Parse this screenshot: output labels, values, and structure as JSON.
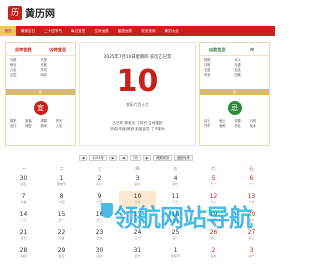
{
  "header": {
    "logo_mark": "历",
    "site_name": "黄历网"
  },
  "nav": [
    {
      "label": "首页",
      "active": true
    },
    {
      "label": "黄道吉日"
    },
    {
      "label": "二十四节气"
    },
    {
      "label": "每日宜忌"
    },
    {
      "label": "生肖运势"
    },
    {
      "label": "星座运势"
    },
    {
      "label": "农历查询"
    },
    {
      "label": "黄历大全"
    }
  ],
  "left_panel": {
    "head_left": "吉神宜趋",
    "head_right": "凶神宜忌",
    "text": [
      "月德",
      "天恩",
      "母仓",
      "天赦",
      "六合",
      "不将",
      "玉堂",
      "鸣吠"
    ],
    "bar": "宜",
    "seal": "宜",
    "items": [
      "祭祀",
      "祈福",
      "求嗣",
      "开光",
      "出行",
      "嫁娶",
      "纳采",
      "入宅"
    ]
  },
  "center": {
    "date_line": "2025年7月10日星期四 农历乙巳年",
    "day": "10",
    "lunar": "农历六月十六",
    "ganzhi_1": "乙巳年 癸未月 丁卯日 生肖属蛇",
    "ganzhi_2": "冲鸡(辛酉)煞西 彭祖百忌 丁不剃头"
  },
  "right_panel": {
    "head_left": "凶煞宜忌",
    "head_right": "冲",
    "text": [
      "劫煞",
      "天火",
      "月煞",
      "月虚",
      "五虚",
      "血支",
      "朱雀",
      "四耗"
    ],
    "bar": "忌",
    "seal": "忌",
    "items": [
      "动土",
      "破土",
      "安葬",
      "行丧",
      "开市",
      "栽种",
      "作灶",
      "伐木"
    ]
  },
  "controls": {
    "year": "2025年",
    "month": "7月",
    "holiday": "假期安排",
    "back_today": "返回今天"
  },
  "weekdays": [
    "一",
    "二",
    "三",
    "四",
    "五",
    "六",
    "日"
  ],
  "calendar": [
    {
      "d": "30",
      "l": "初五"
    },
    {
      "d": "1",
      "l": "建党节"
    },
    {
      "d": "2",
      "l": "初八"
    },
    {
      "d": "3",
      "l": "初九"
    },
    {
      "d": "4",
      "l": "初十"
    },
    {
      "d": "5",
      "l": "十一"
    },
    {
      "d": "6",
      "l": "十二"
    },
    {
      "d": "7",
      "l": "小暑"
    },
    {
      "d": "8",
      "l": "十四"
    },
    {
      "d": "9",
      "l": "十五"
    },
    {
      "d": "10",
      "l": "十六"
    },
    {
      "d": "11",
      "l": "十七"
    },
    {
      "d": "12",
      "l": "十八"
    },
    {
      "d": "13",
      "l": "十九"
    },
    {
      "d": "14",
      "l": "二十"
    },
    {
      "d": "15",
      "l": "廿一"
    },
    {
      "d": "16",
      "l": "廿二"
    },
    {
      "d": "17",
      "l": "廿三"
    },
    {
      "d": "18",
      "l": "廿四"
    },
    {
      "d": "19",
      "l": "廿五"
    },
    {
      "d": "20",
      "l": "廿六"
    },
    {
      "d": "21",
      "l": "廿七"
    },
    {
      "d": "22",
      "l": "大暑"
    },
    {
      "d": "23",
      "l": "廿九"
    },
    {
      "d": "24",
      "l": "三十"
    },
    {
      "d": "25",
      "l": "初一"
    },
    {
      "d": "26",
      "l": "初二"
    },
    {
      "d": "27",
      "l": "初三"
    },
    {
      "d": "28",
      "l": "初四"
    },
    {
      "d": "29",
      "l": "初五"
    },
    {
      "d": "30",
      "l": "初六"
    },
    {
      "d": "31",
      "l": "初七"
    },
    {
      "d": "1",
      "l": "建军节"
    },
    {
      "d": "2",
      "l": "初九"
    },
    {
      "d": "3",
      "l": "初十"
    }
  ],
  "watermark": "领航网站导航",
  "colors": {
    "brand": "#c8211b",
    "accent": "#f3c95d",
    "gold": "#d9b873",
    "watermark": "#18a6e0"
  }
}
